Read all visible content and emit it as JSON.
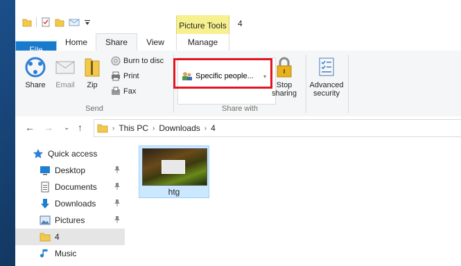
{
  "window": {
    "title": "4",
    "context_tab": "Picture Tools"
  },
  "tabs": {
    "file": "File",
    "home": "Home",
    "share": "Share",
    "view": "View",
    "manage": "Manage"
  },
  "ribbon": {
    "send": {
      "label": "Send",
      "share": "Share",
      "email": "Email",
      "zip": "Zip",
      "burn": "Burn to disc",
      "print": "Print",
      "fax": "Fax"
    },
    "share_with": {
      "label": "Share with",
      "selected": "Specific people...",
      "stop_sharing": "Stop sharing",
      "stop_line1": "Stop",
      "stop_line2": "sharing"
    },
    "advanced": {
      "line1": "Advanced",
      "line2": "security"
    }
  },
  "address": {
    "crumbs": [
      "This PC",
      "Downloads",
      "4"
    ]
  },
  "nav": {
    "items": [
      {
        "label": "Quick access",
        "icon": "star-icon",
        "pinned": false
      },
      {
        "label": "Desktop",
        "icon": "desktop-icon",
        "pinned": true
      },
      {
        "label": "Documents",
        "icon": "documents-icon",
        "pinned": true
      },
      {
        "label": "Downloads",
        "icon": "downloads-icon",
        "pinned": true
      },
      {
        "label": "Pictures",
        "icon": "pictures-icon",
        "pinned": true
      },
      {
        "label": "4",
        "icon": "folder-icon",
        "pinned": false
      },
      {
        "label": "Music",
        "icon": "music-icon",
        "pinned": false
      }
    ]
  },
  "files": [
    {
      "name": "htg"
    }
  ],
  "colors": {
    "file_tab": "#1979ca",
    "context_tab": "#f7f08e",
    "selection": "#cce8ff",
    "highlight": "#e3141f"
  }
}
